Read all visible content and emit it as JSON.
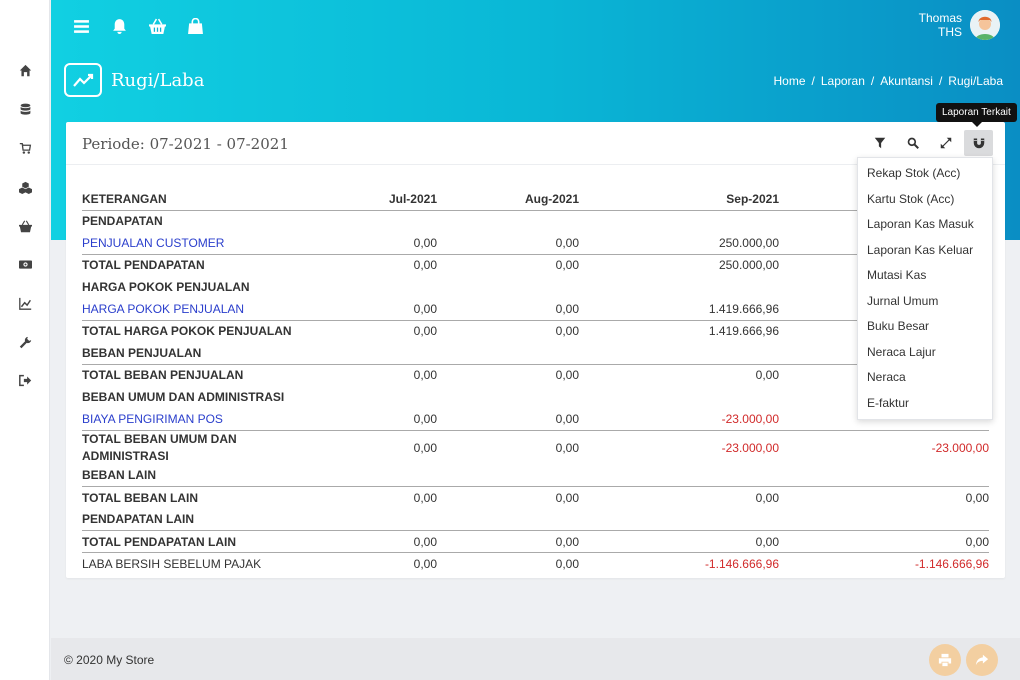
{
  "sidebar": {
    "items": [
      {
        "icon": "home-icon"
      },
      {
        "icon": "database-icon"
      },
      {
        "icon": "cart-icon"
      },
      {
        "icon": "cubes-icon"
      },
      {
        "icon": "basket-icon"
      },
      {
        "icon": "money-icon"
      },
      {
        "icon": "line-chart-icon"
      },
      {
        "icon": "wrench-icon"
      },
      {
        "icon": "sign-out-icon"
      }
    ]
  },
  "header": {
    "user_name": "Thomas",
    "user_code": "THS",
    "page_title": "Rugi/Laba",
    "breadcrumb": [
      "Home",
      "Laporan",
      "Akuntansi",
      "Rugi/Laba"
    ],
    "breadcrumb_sep": "/"
  },
  "tooltip": "Laporan Terkait",
  "card": {
    "periode": "Periode: 07-2021 - 07-2021"
  },
  "table": {
    "headers": [
      "KETERANGAN",
      "Jul-2021",
      "Aug-2021",
      "Sep-2021"
    ],
    "rows": [
      {
        "label": "PENDAPATAN"
      },
      {
        "label": "PENJUALAN CUSTOMER",
        "v": [
          "0,00",
          "0,00",
          "250.000,00"
        ]
      },
      {
        "label": "TOTAL PENDAPATAN",
        "v": [
          "0,00",
          "0,00",
          "250.000,00"
        ]
      },
      {
        "label": "HARGA POKOK PENJUALAN"
      },
      {
        "label": "HARGA POKOK PENJUALAN",
        "v": [
          "0,00",
          "0,00",
          "1.419.666,96"
        ]
      },
      {
        "label": "TOTAL HARGA POKOK PENJUALAN",
        "v": [
          "0,00",
          "0,00",
          "1.419.666,96"
        ]
      },
      {
        "label": "BEBAN PENJUALAN"
      },
      {
        "label": "TOTAL BEBAN PENJUALAN",
        "v": [
          "0,00",
          "0,00",
          "0,00"
        ]
      },
      {
        "label": "BEBAN UMUM DAN ADMINISTRASI"
      },
      {
        "label": "BIAYA PENGIRIMAN POS",
        "v": [
          "0,00",
          "0,00",
          "-23.000,00"
        ]
      },
      {
        "label": "TOTAL BEBAN UMUM DAN ADMINISTRASI",
        "v": [
          "0,00",
          "0,00",
          "-23.000,00",
          "-23.000,00"
        ]
      },
      {
        "label": "BEBAN LAIN"
      },
      {
        "label": "TOTAL BEBAN LAIN",
        "v": [
          "0,00",
          "0,00",
          "0,00",
          "0,00"
        ]
      },
      {
        "label": "PENDAPATAN LAIN"
      },
      {
        "label": "TOTAL PENDAPATAN LAIN",
        "v": [
          "0,00",
          "0,00",
          "0,00",
          "0,00"
        ]
      },
      {
        "label": "LABA BERSIH SEBELUM PAJAK",
        "v": [
          "0,00",
          "0,00",
          "-1.146.666,96",
          "-1.146.666,96"
        ]
      }
    ]
  },
  "dropdown": {
    "items": [
      "Rekap Stok (Acc)",
      "Kartu Stok (Acc)",
      "Laporan Kas Masuk",
      "Laporan Kas Keluar",
      "Mutasi Kas",
      "Jurnal Umum",
      "Buku Besar",
      "Neraca Lajur",
      "Neraca",
      "E-faktur"
    ]
  },
  "footer": {
    "copyright": "© 2020 My Store"
  },
  "colors": {
    "header_start": "#11d0e2",
    "header_end": "#0a8ec4",
    "link": "#2a3ecc",
    "negative": "#d12a2a",
    "fab": "#f3cfa1"
  }
}
